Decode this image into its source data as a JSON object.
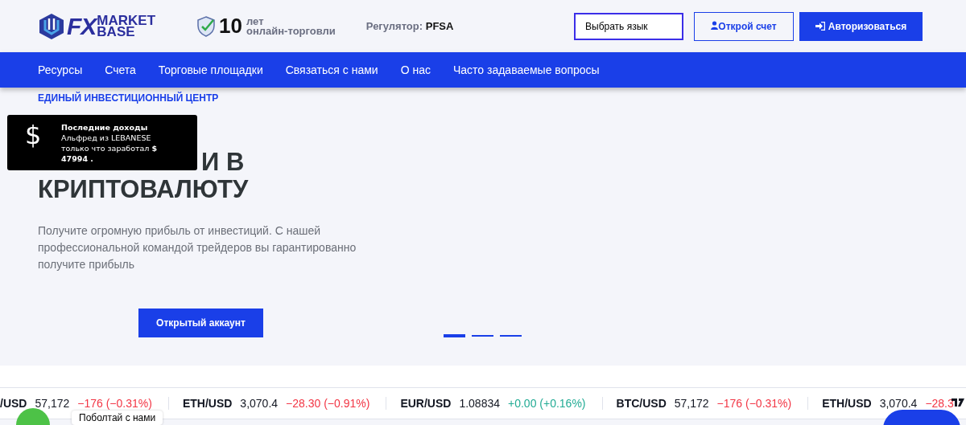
{
  "header": {
    "logo": {
      "big": "FX",
      "top": "MARKET",
      "bottom": "BASE"
    },
    "experience": {
      "number": "10",
      "unit": "лет",
      "caption": "онлайн-торговли"
    },
    "regulator": {
      "label": "Регулятор:",
      "value": "PFSA"
    },
    "language_select": {
      "value": "Выбрать язык"
    },
    "open_account_button": "Открой счет",
    "login_button": "Авторизоваться"
  },
  "nav": [
    "Ресурсы",
    "Счета",
    "Торговые площадки",
    "Связаться с нами",
    "О нас",
    "Часто задаваемые вопросы"
  ],
  "hero": {
    "eyebrow": "ЕДИНЫЙ ИНВЕСТИЦИОННЫЙ ЦЕНТР",
    "headline": [
      "И В",
      "КРИПТОВАЛЮТУ"
    ],
    "text": "Получите огромную прибыль от инвестиций. С нашей профессиональной командой трейдеров вы гарантированно получите прибыль",
    "button": "Открытый аккаунт",
    "slides": [
      {
        "selected": true
      },
      {
        "selected": false
      },
      {
        "selected": false
      }
    ]
  },
  "toast": {
    "icon": "$",
    "title": "Последние доходы",
    "text": "Альфред из LEBANESE только что заработал **$ 47994 .**"
  },
  "ticker": [
    {
      "symbol": "/USD",
      "price": "57,172",
      "change": "−176 (−0.31%)",
      "kind": "down"
    },
    {
      "symbol": "ETH/USD",
      "price": "3,070.4",
      "change": "−28.30 (−0.91%)",
      "kind": "down"
    },
    {
      "symbol": "EUR/USD",
      "price": "1.08834",
      "change": "+0.00 (+0.16%)",
      "kind": "up"
    },
    {
      "symbol": "BTC/USD",
      "price": "57,172",
      "change": "−176 (−0.31%)",
      "kind": "down"
    },
    {
      "symbol": "ETH/USD",
      "price": "3,070.4",
      "change": "−28.3",
      "kind": "down"
    }
  ],
  "chat_label": "Поболтай с нами"
}
